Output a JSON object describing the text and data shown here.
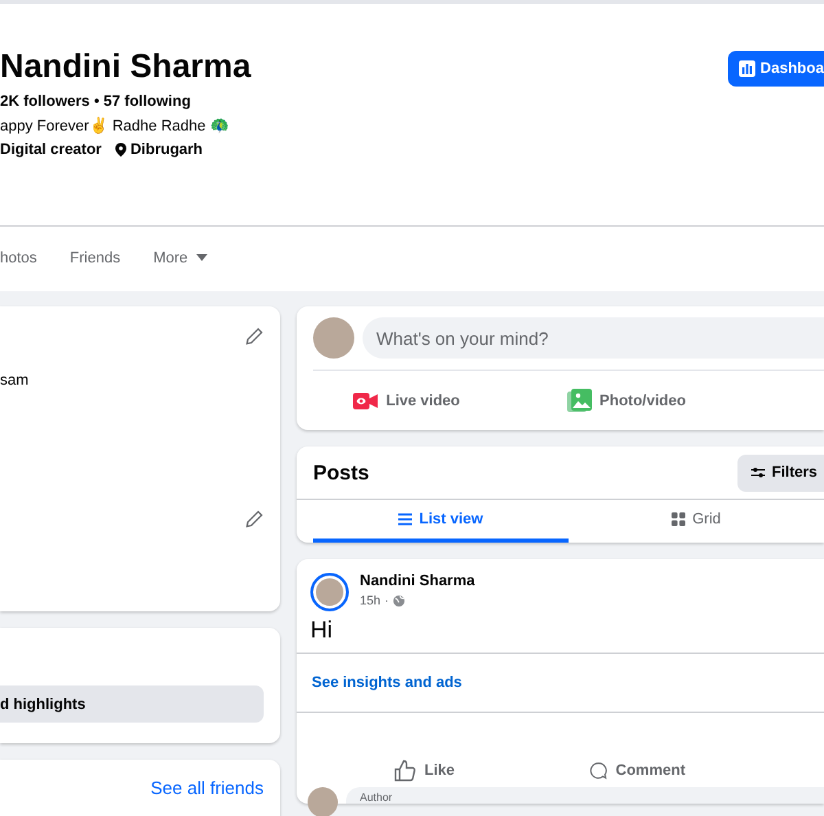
{
  "profile": {
    "name": "Nandini Sharma",
    "stats": "2K followers • 57 following",
    "bio": "appy Forever✌ Radhe Radhe 🦚",
    "details": [
      {
        "kind": "work",
        "text": "Digital creator"
      },
      {
        "kind": "place",
        "text": "Dibrugarh"
      }
    ],
    "dashboard_button": "Dashboa"
  },
  "profile_tabs": [
    {
      "label": "hotos",
      "selected": false
    },
    {
      "label": "Friends",
      "selected": false
    },
    {
      "label": "More",
      "selected": false,
      "kind": "menu"
    }
  ],
  "intro": {
    "text": "sam"
  },
  "highlights": {
    "button": "d highlights"
  },
  "friends": {
    "link": "See all friends"
  },
  "composer": {
    "placeholder": "What's on your mind?",
    "actions": [
      {
        "kind": "live",
        "label": "Live video"
      },
      {
        "kind": "photo",
        "label": "Photo/video"
      }
    ]
  },
  "posts": {
    "title": "Posts",
    "filters": "Filters",
    "views": [
      {
        "kind": "list",
        "label": "List view",
        "selected": true
      },
      {
        "kind": "grid",
        "label": "Grid",
        "selected": false
      }
    ]
  },
  "post": {
    "author": "Nandini Sharma",
    "time": "15h",
    "separator": "·",
    "text": "Hi",
    "insights_link": "See insights and ads",
    "actions": [
      {
        "kind": "like",
        "label": "Like"
      },
      {
        "kind": "comment",
        "label": "Comment"
      }
    ],
    "comment_badge": "Author"
  }
}
